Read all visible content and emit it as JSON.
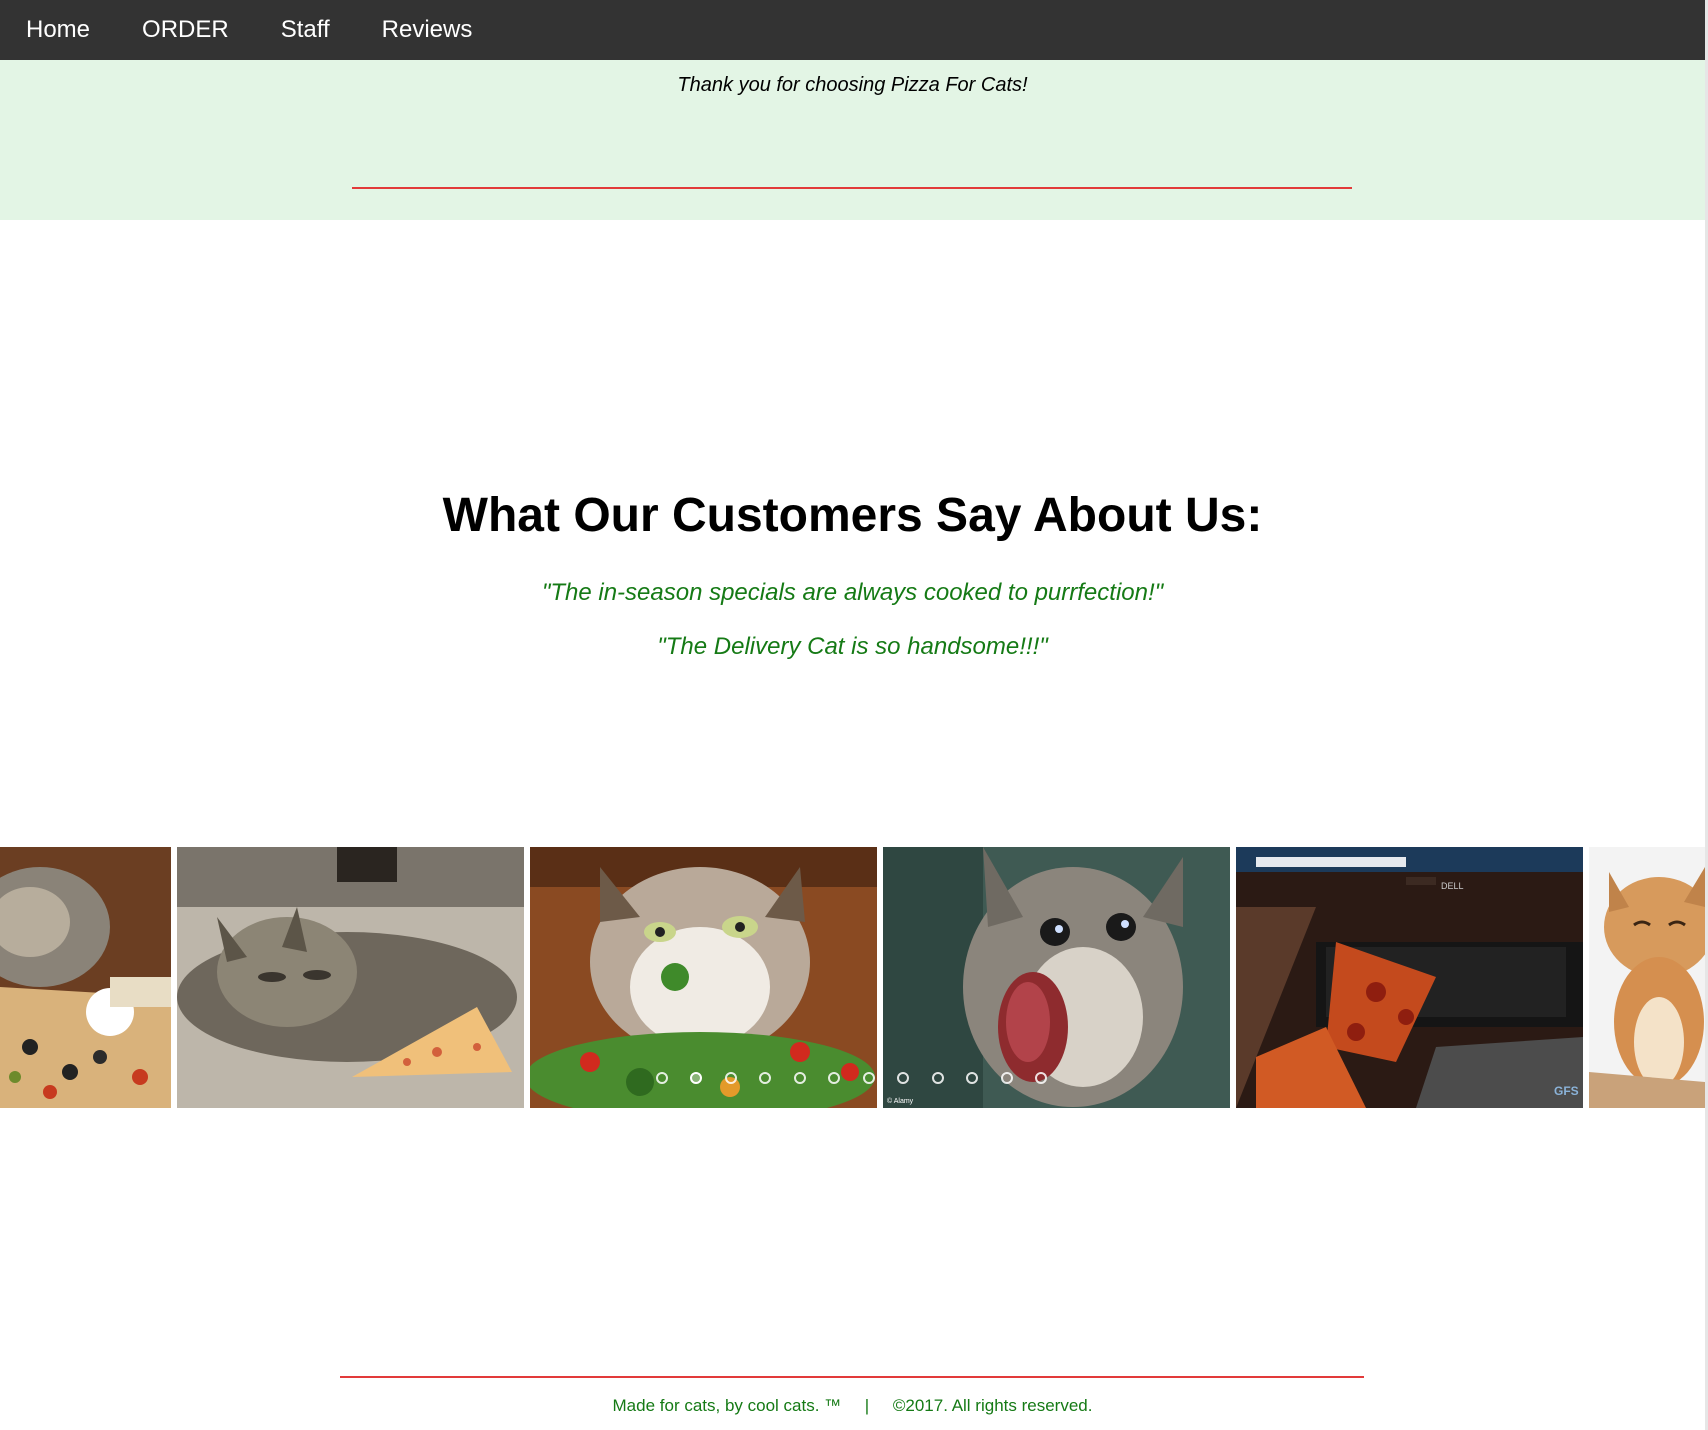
{
  "nav": {
    "items": [
      {
        "label": "Home"
      },
      {
        "label": "ORDER"
      },
      {
        "label": "Staff"
      },
      {
        "label": "Reviews"
      }
    ]
  },
  "banner": {
    "text": "Thank you for choosing Pizza For Cats!"
  },
  "reviews": {
    "heading": "What Our Customers Say About Us:",
    "quotes": [
      "\"The in-season specials are always cooked to purrfection!\"",
      "\"The Delivery Cat is so handsome!!!\""
    ]
  },
  "carousel": {
    "slides": [
      {
        "icon": "cat-on-pizza-image"
      },
      {
        "icon": "cat-sleeping-with-pizza-slice-image"
      },
      {
        "icon": "cat-eating-salad-image"
      },
      {
        "icon": "kitten-eating-meat-image"
      },
      {
        "icon": "pizza-on-keyboard-image"
      },
      {
        "icon": "smiling-cat-image"
      }
    ],
    "dot_count": 12,
    "active_dot": 1,
    "watermarks": {
      "kitten": "© Alamy",
      "keyboard": "GFS",
      "monitor": "DELL"
    }
  },
  "footer": {
    "made_for": "Made for cats, by cool cats. ™",
    "separator": "|",
    "copyright": "©2017. All rights reserved."
  },
  "colors": {
    "navbar": "#333333",
    "banner_bg": "#e3f5e5",
    "accent_red": "#e23a3a",
    "quote_green": "#157a15"
  }
}
